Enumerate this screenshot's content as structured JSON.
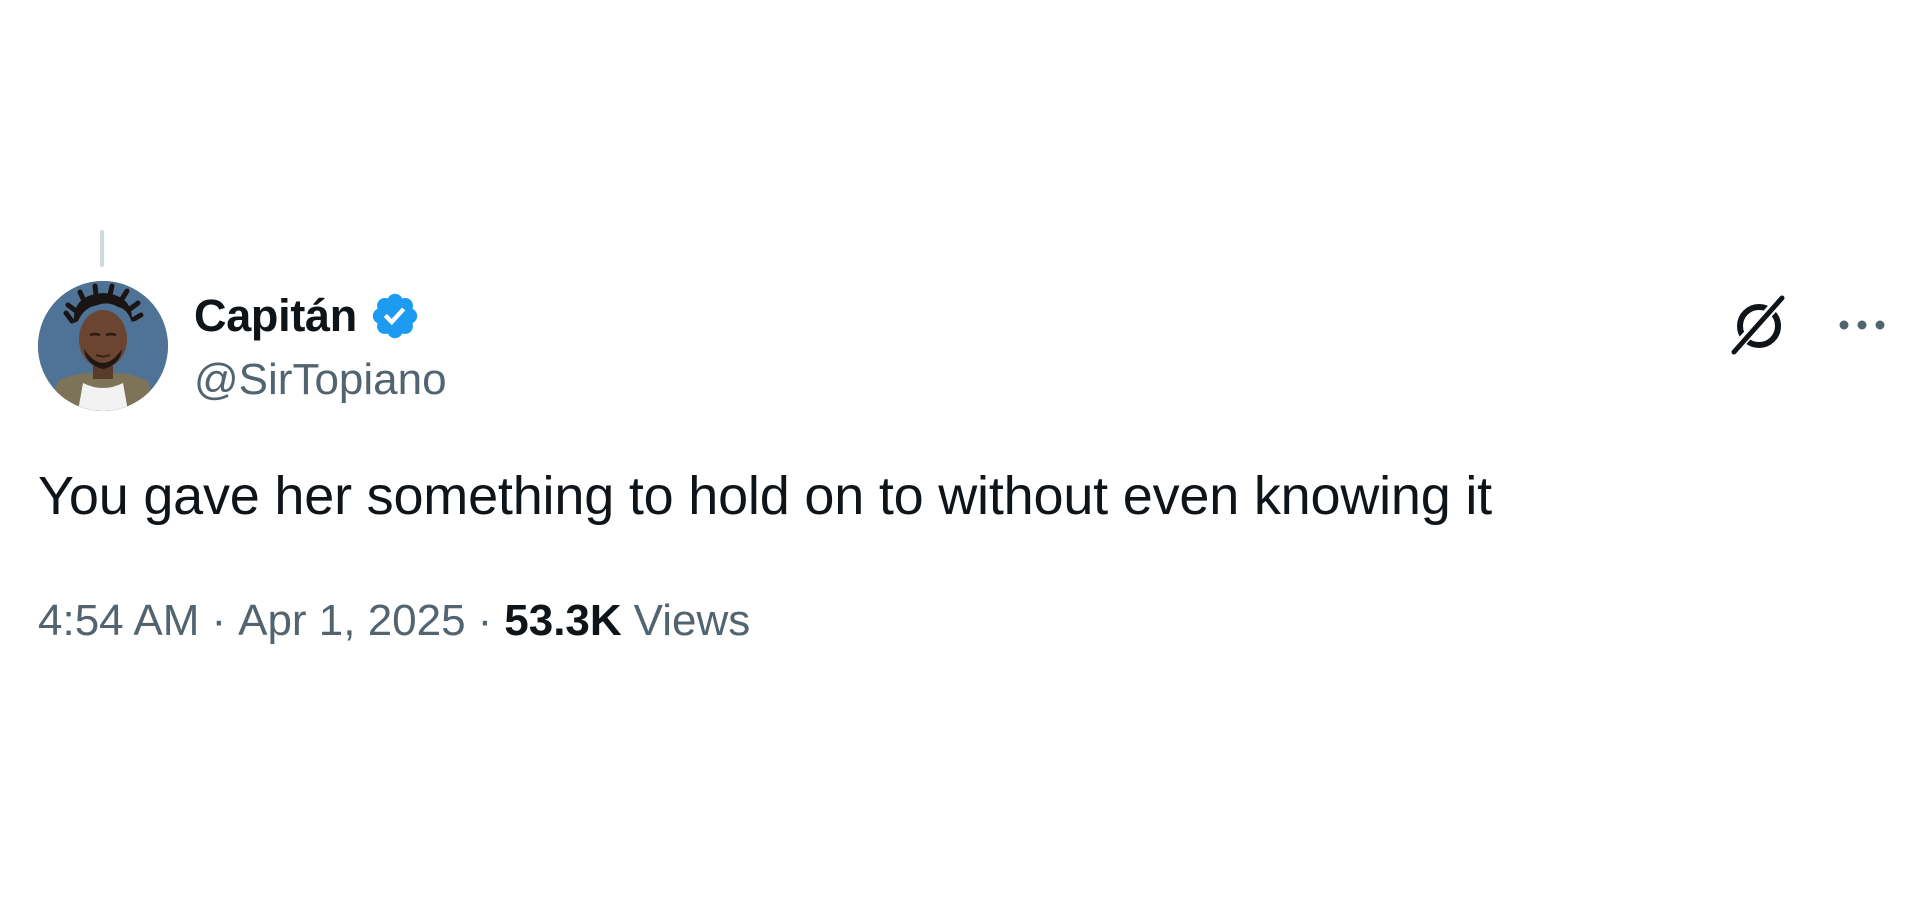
{
  "tweet": {
    "author": {
      "display_name": "Capitán",
      "handle": "@SirTopiano",
      "verified": true,
      "verified_color": "#1d9bf0"
    },
    "text": "You gave her something to hold on to without even knowing it",
    "time": "4:54 AM",
    "date": "Apr 1, 2025",
    "separator": "·",
    "views_count": "53.3K",
    "views_label": "Views"
  },
  "icons": {
    "verified": "verified-badge-icon",
    "grok": "grok-icon",
    "more": "more-options-icon"
  },
  "colors": {
    "text_primary": "#0f1419",
    "text_secondary": "#536471",
    "thread_line": "#cfd9de",
    "accent": "#1d9bf0"
  }
}
